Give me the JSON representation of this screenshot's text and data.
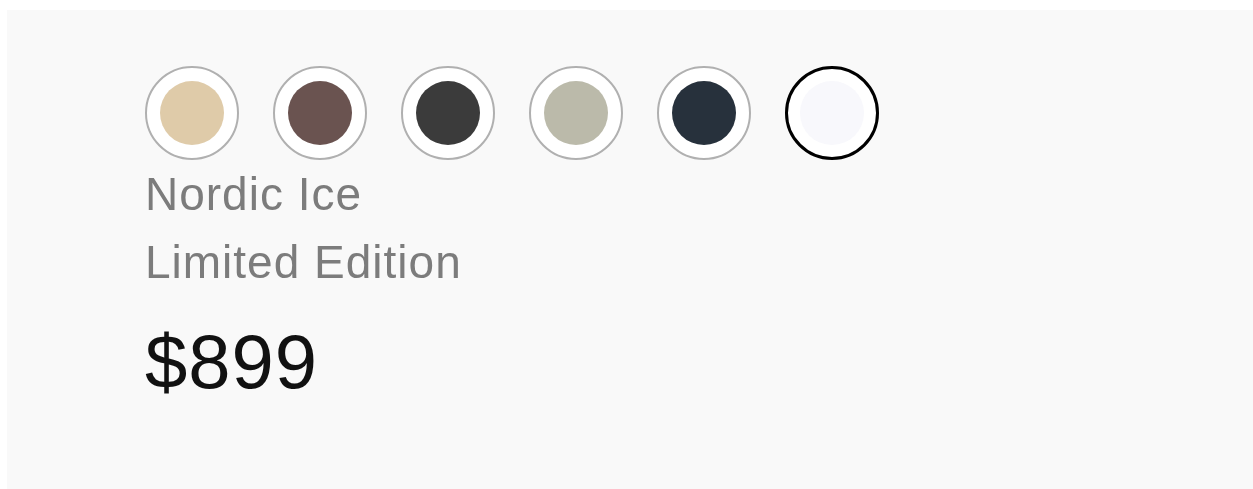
{
  "swatches": [
    {
      "color": "#dfcba9",
      "selected": false
    },
    {
      "color": "#6a5350",
      "selected": false
    },
    {
      "color": "#3b3b3b",
      "selected": false
    },
    {
      "color": "#bbbaaa",
      "selected": false
    },
    {
      "color": "#27313c",
      "selected": false
    },
    {
      "color": "#f8f8fc",
      "selected": true
    }
  ],
  "product": {
    "name": "Nordic Ice",
    "edition": "Limited Edition",
    "price": "$899"
  }
}
